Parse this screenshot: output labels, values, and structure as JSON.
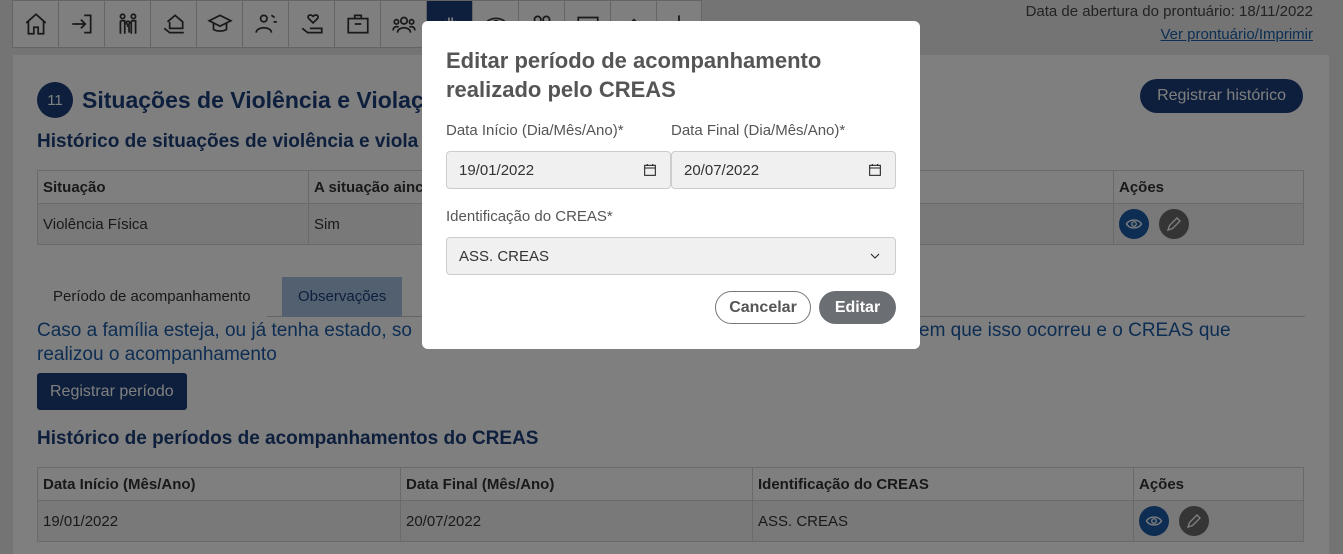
{
  "toolbar": {
    "icons": [
      "home-icon",
      "login-icon",
      "family-icon",
      "house-hand-icon",
      "graduation-icon",
      "worker-icon",
      "heart-hand-icon",
      "briefcase-icon",
      "group-icon",
      "hand-icon",
      "eye-icon",
      "people-icon",
      "card-icon",
      "up-icon",
      "extra-icon"
    ]
  },
  "header": {
    "opened_date": "Data de abertura do prontuário: 18/11/2022",
    "print_link": "Ver prontuário/Imprimir"
  },
  "section": {
    "number": "11",
    "title": "Situações de Violência e Violaç",
    "register_history_btn": "Registrar histórico",
    "history_title": "Histórico de situações de violência e viola",
    "table1": {
      "headers": [
        "Situação",
        "A situação ainc",
        "Ações"
      ],
      "rows": [
        [
          "Violência Física",
          "Sim"
        ]
      ]
    },
    "tabs": [
      "Período de acompanhamento",
      "Observações"
    ],
    "paragraph_left": "Caso a família esteja, ou já tenha estado, so",
    "paragraph_right": "em que isso ocorreu e o CREAS que",
    "paragraph_line2": "realizou o acompanhamento",
    "register_period_btn": "Registrar período",
    "periods_title": "Histórico de períodos de acompanhamentos do CREAS",
    "table2": {
      "headers": [
        "Data Início (Mês/Ano)",
        "Data Final (Mês/Ano)",
        "Identificação do CREAS",
        "Ações"
      ],
      "rows": [
        [
          "19/01/2022",
          "20/07/2022",
          "ASS. CREAS"
        ]
      ]
    }
  },
  "modal": {
    "title": "Editar período de acompanhamento realizado pelo CREAS",
    "start_label": "Data Início (Dia/Mês/Ano)*",
    "start_value": "19/01/2022",
    "end_label": "Data Final (Dia/Mês/Ano)*",
    "end_value": "20/07/2022",
    "creas_label": "Identificação do CREAS*",
    "creas_value": "ASS. CREAS",
    "cancel_btn": "Cancelar",
    "edit_btn": "Editar"
  }
}
